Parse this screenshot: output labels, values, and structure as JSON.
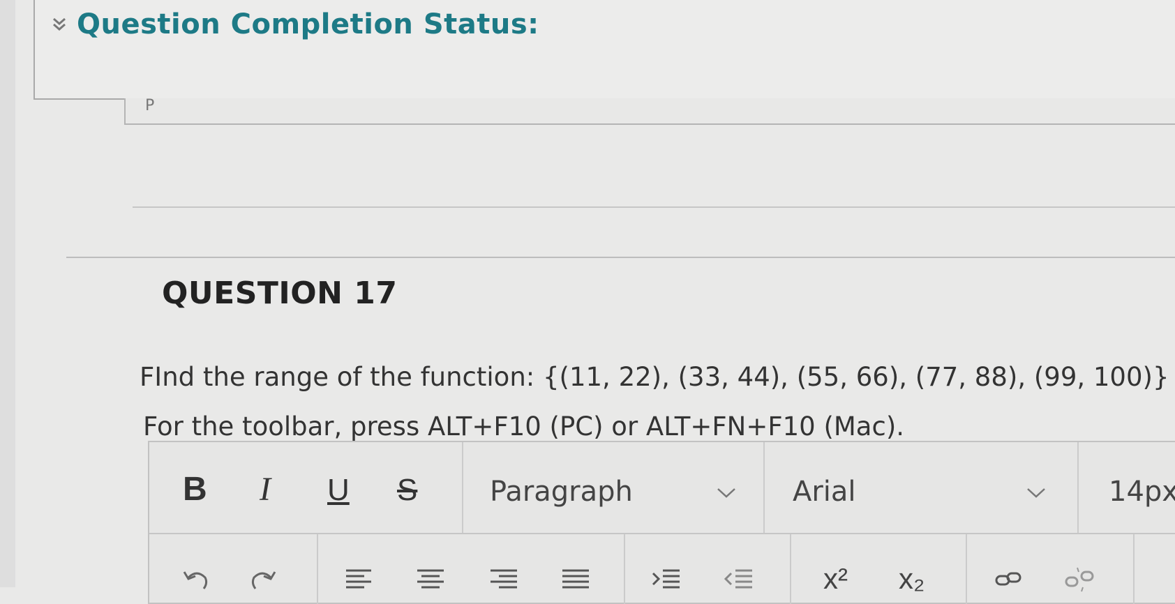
{
  "status_header": {
    "title": "Question Completion Status:"
  },
  "previous_question": {
    "fragment": "P"
  },
  "question": {
    "number_label": "QUESTION 17",
    "text": "FInd the range of the  function: {(11, 22), (33, 44), (55, 66), (77, 88), (99, 100)}",
    "toolbar_hint": "For the toolbar, press ALT+F10 (PC) or ALT+FN+F10 (Mac)."
  },
  "editor_toolbar": {
    "bold": "B",
    "italic": "I",
    "underline": "U",
    "strikethrough": "S",
    "paragraph_select": "Paragraph",
    "font_select": "Arial",
    "size_select": "14px",
    "superscript": "x²",
    "subscript": "x₂"
  },
  "colors": {
    "accent": "#1d7a86",
    "text": "#333333",
    "background": "#e9e9e8"
  }
}
